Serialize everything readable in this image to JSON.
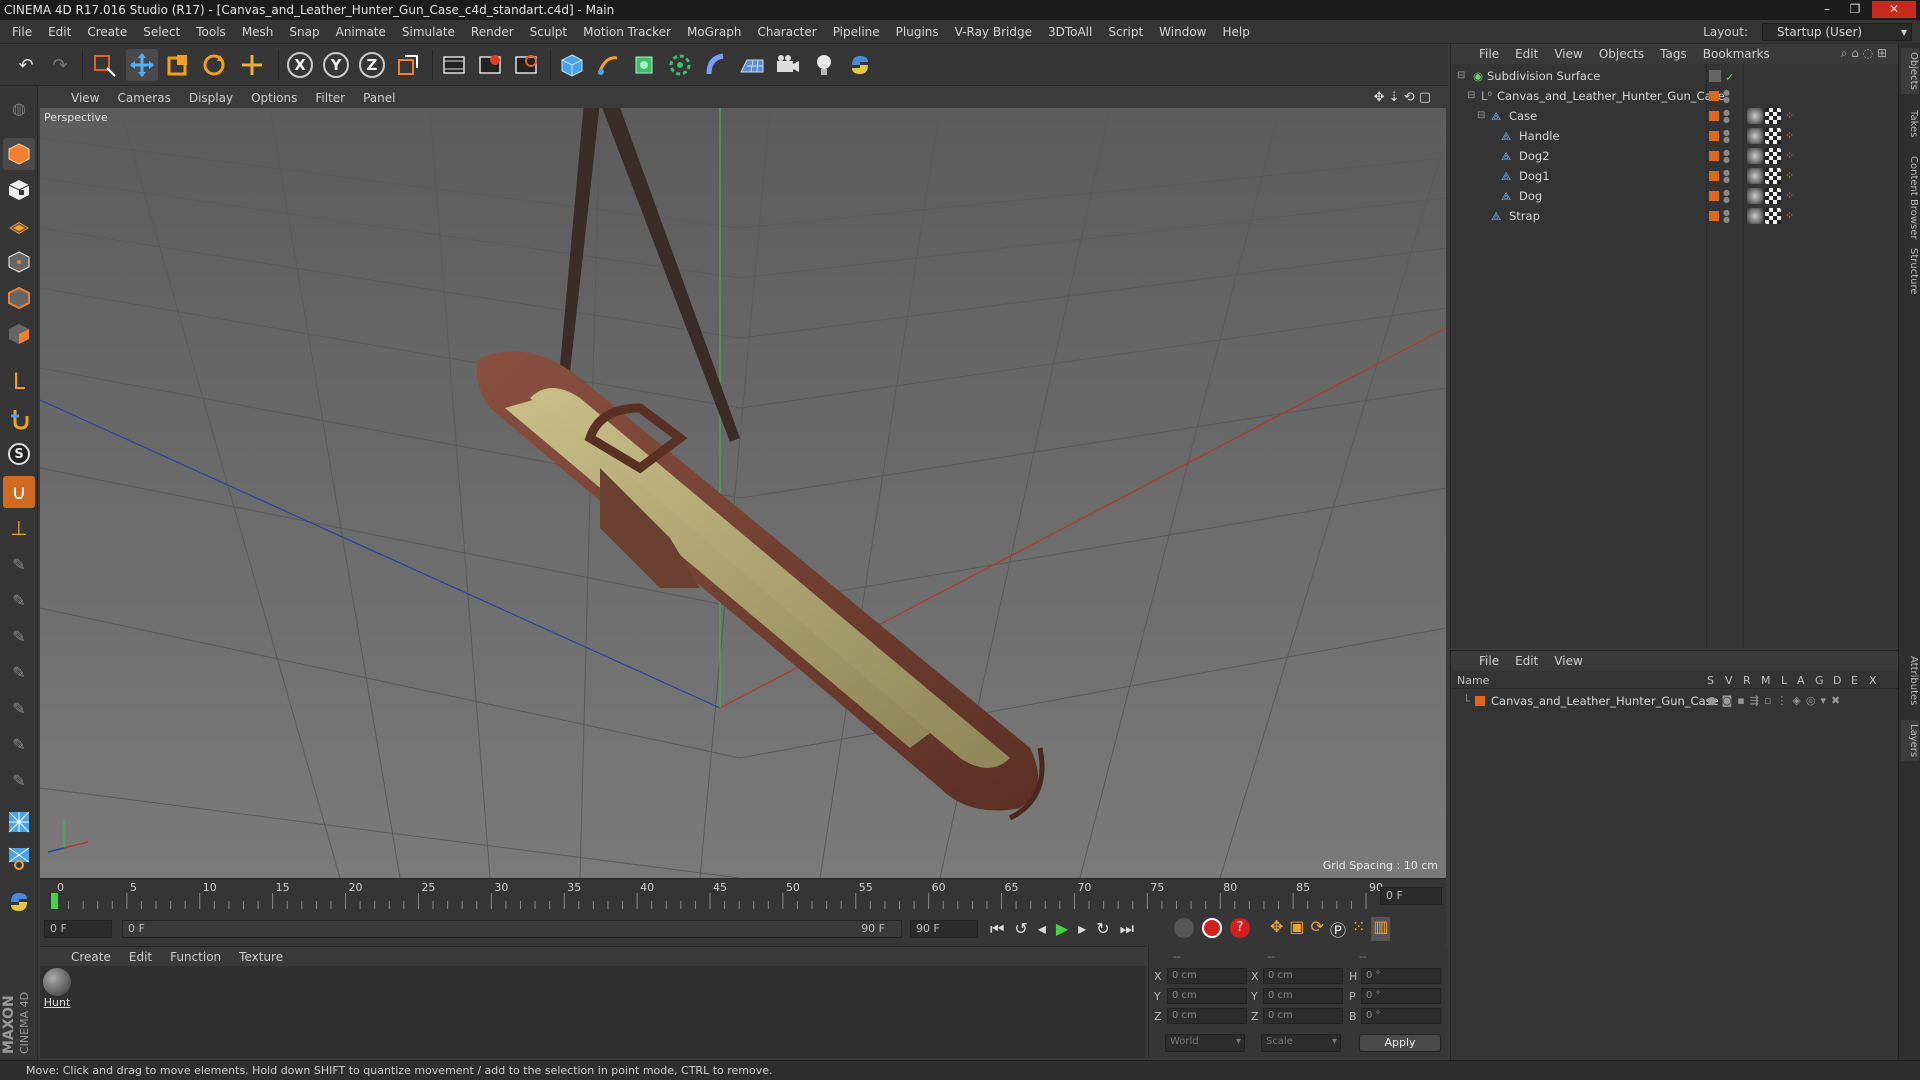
{
  "window": {
    "title": "CINEMA 4D R17.016 Studio (R17) - [Canvas_and_Leather_Hunter_Gun_Case_c4d_standart.c4d] - Main",
    "controls": [
      "–",
      "❐",
      "✕"
    ]
  },
  "menubar": {
    "items": [
      "File",
      "Edit",
      "Create",
      "Select",
      "Tools",
      "Mesh",
      "Snap",
      "Animate",
      "Simulate",
      "Render",
      "Sculpt",
      "Motion Tracker",
      "MoGraph",
      "Character",
      "Pipeline",
      "Plugins",
      "V-Ray Bridge",
      "3DToAll",
      "Script",
      "Window",
      "Help"
    ],
    "layout_label": "Layout:",
    "layout_value": "Startup (User)"
  },
  "toolbar": {
    "icons": [
      "undo-icon",
      "redo-icon",
      "live-selection-icon",
      "move-icon",
      "scale-icon",
      "rotate-icon",
      "move-plus-icon",
      "x-axis-icon",
      "y-axis-icon",
      "z-axis-icon",
      "world-coordinates-icon",
      "render-view-icon",
      "render-picture-viewer-icon",
      "render-settings-icon",
      "cube-icon",
      "pen-icon",
      "nurbs-icon",
      "array-icon",
      "deformer-icon",
      "floor-icon",
      "camera-icon",
      "light-icon",
      "python-icon"
    ],
    "axis_labels": [
      "X",
      "Y",
      "Z"
    ]
  },
  "viewport": {
    "menu": [
      "View",
      "Cameras",
      "Display",
      "Options",
      "Filter",
      "Panel"
    ],
    "camera_label": "Perspective",
    "grid_spacing": "Grid Spacing : 10 cm"
  },
  "timeline": {
    "ticks": [
      "0",
      "5",
      "10",
      "15",
      "20",
      "25",
      "30",
      "35",
      "40",
      "45",
      "50",
      "55",
      "60",
      "65",
      "70",
      "75",
      "80",
      "85",
      "90"
    ],
    "current_frame": "0 F",
    "start_field": "0 F",
    "range_start": "0 F",
    "range_end": "90 F",
    "end_field": "90 F"
  },
  "materials": {
    "menu": [
      "Create",
      "Edit",
      "Function",
      "Texture"
    ],
    "items": [
      {
        "name": "Hunt"
      }
    ]
  },
  "coordinates": {
    "headers": [
      "--",
      "--",
      "--"
    ],
    "rows": [
      {
        "l1": "X",
        "v1": "0 cm",
        "l2": "X",
        "v2": "0 cm",
        "l3": "H",
        "v3": "0 °"
      },
      {
        "l1": "Y",
        "v1": "0 cm",
        "l2": "Y",
        "v2": "0 cm",
        "l3": "P",
        "v3": "0 °"
      },
      {
        "l1": "Z",
        "v1": "0 cm",
        "l2": "Z",
        "v2": "0 cm",
        "l3": "B",
        "v3": "0 °"
      }
    ],
    "mode": "World",
    "size_mode": "Scale",
    "apply_label": "Apply"
  },
  "objects_panel": {
    "menu": [
      "File",
      "Edit",
      "View",
      "Objects",
      "Tags",
      "Bookmarks"
    ],
    "tree": [
      {
        "name": "Subdivision Surface",
        "depth": 0,
        "icon": "subdivision-icon"
      },
      {
        "name": "Canvas_and_Leather_Hunter_Gun_Case",
        "depth": 1,
        "icon": "null-icon"
      },
      {
        "name": "Case",
        "depth": 2,
        "icon": "bone-icon"
      },
      {
        "name": "Handle",
        "depth": 3,
        "icon": "bone-icon"
      },
      {
        "name": "Dog2",
        "depth": 3,
        "icon": "bone-icon"
      },
      {
        "name": "Dog1",
        "depth": 3,
        "icon": "bone-icon"
      },
      {
        "name": "Dog",
        "depth": 3,
        "icon": "bone-icon"
      },
      {
        "name": "Strap",
        "depth": 2,
        "icon": "bone-icon"
      }
    ]
  },
  "layers_panel": {
    "menu": [
      "File",
      "Edit",
      "View"
    ],
    "columns": [
      "Name",
      "S",
      "V",
      "R",
      "M",
      "L",
      "A",
      "G",
      "D",
      "E",
      "X"
    ],
    "rows": [
      {
        "name": "Canvas_and_Leather_Hunter_Gun_Case"
      }
    ]
  },
  "right_tabs": [
    "Objects",
    "Takes",
    "Content Browser",
    "Structure",
    "Attributes",
    "Layers"
  ],
  "status": "Move: Click and drag to move elements. Hold down SHIFT to quantize movement / add to the selection in point mode, CTRL to remove.",
  "brand": {
    "maxon": "MAXON",
    "cinema": "CINEMA 4D"
  },
  "colors": {
    "accent_orange": "#e0681a",
    "axis_x": "#c0392b",
    "axis_y": "#2ecc71",
    "axis_z": "#3050c0",
    "play_green": "#3fd63f"
  }
}
